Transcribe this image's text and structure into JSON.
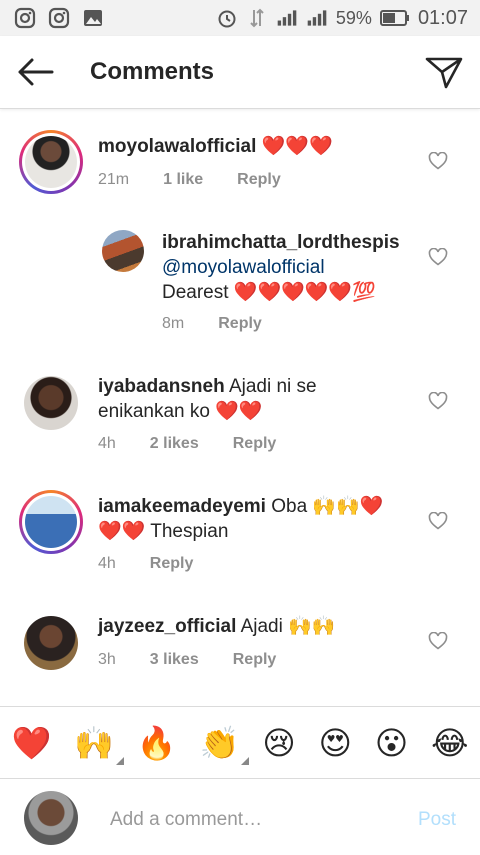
{
  "status": {
    "battery": "59%",
    "time": "01:07"
  },
  "header": {
    "title": "Comments"
  },
  "comments": [
    {
      "username": "moyolawalofficial",
      "text": "❤️❤️❤️",
      "time": "21m",
      "likes": "1 like",
      "reply": "Reply"
    },
    {
      "username": "ibrahimchatta_lordthespis",
      "mention": "@moyolawalofficial",
      "text": "Dearest ❤️❤️❤️❤️❤️💯",
      "time": "8m",
      "reply": "Reply"
    },
    {
      "username": "iyabadansneh",
      "text_line1": "Ajadi ni se",
      "text_line2": "enikankan ko ❤️❤️",
      "time": "4h",
      "likes": "2 likes",
      "reply": "Reply"
    },
    {
      "username": "iamakeemadeyemi",
      "text_line1": "Oba 🙌🙌❤️",
      "text_line2": "❤️❤️ Thespian",
      "time": "4h",
      "reply": "Reply"
    },
    {
      "username": "jayzeez_official",
      "text": "Ajadi 🙌🙌",
      "time": "3h",
      "likes": "3 likes",
      "reply": "Reply"
    }
  ],
  "emojis": [
    "❤️",
    "🙌",
    "🔥",
    "👏",
    "😢",
    "😍",
    "😮",
    "😂"
  ],
  "composer": {
    "placeholder": "Add a comment…",
    "post_label": "Post"
  }
}
